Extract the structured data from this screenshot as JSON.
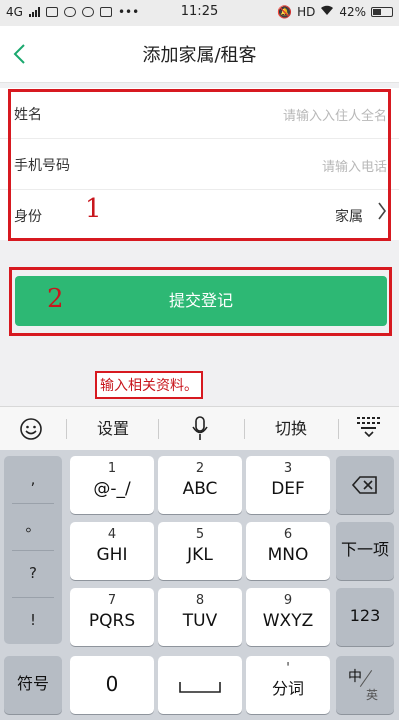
{
  "status_bar": {
    "network": "4G",
    "time": "11:25",
    "hd": "HD",
    "battery": "42%"
  },
  "nav": {
    "back_icon": "chevron-left-icon",
    "title": "添加家属/租客"
  },
  "form": {
    "name_label": "姓名",
    "name_placeholder": "请输入入住人全名",
    "phone_label": "手机号码",
    "phone_placeholder": "请输入电话",
    "identity_label": "身份",
    "identity_value": "家属"
  },
  "annotations": {
    "marker_1": "1",
    "marker_2": "2",
    "note": "输入相关资料。"
  },
  "submit_label": "提交登记",
  "keyboard_toolbar": {
    "emoji_icon": "emoji-icon",
    "settings": "设置",
    "mic_icon": "microphone-icon",
    "switch": "切换",
    "collapse_icon": "keyboard-collapse-icon"
  },
  "keyboard": {
    "symbols": [
      ",",
      "。",
      "?",
      "!"
    ],
    "keys": [
      {
        "num": "1",
        "letters": "@-_/"
      },
      {
        "num": "2",
        "letters": "ABC"
      },
      {
        "num": "3",
        "letters": "DEF"
      },
      {
        "num": "4",
        "letters": "GHI"
      },
      {
        "num": "5",
        "letters": "JKL"
      },
      {
        "num": "6",
        "letters": "MNO"
      },
      {
        "num": "7",
        "letters": "PQRS"
      },
      {
        "num": "8",
        "letters": "TUV"
      },
      {
        "num": "9",
        "letters": "WXYZ"
      }
    ],
    "delete_icon": "backspace-icon",
    "next": "下一项",
    "num123": "123",
    "symbol": "符号",
    "zero": "0",
    "space_icon": "space-icon",
    "segment_dot": "'",
    "segment": "分词",
    "lang_zh": "中",
    "lang_en": "英"
  },
  "colors": {
    "accent": "#2db874",
    "annotation": "#d71920"
  }
}
